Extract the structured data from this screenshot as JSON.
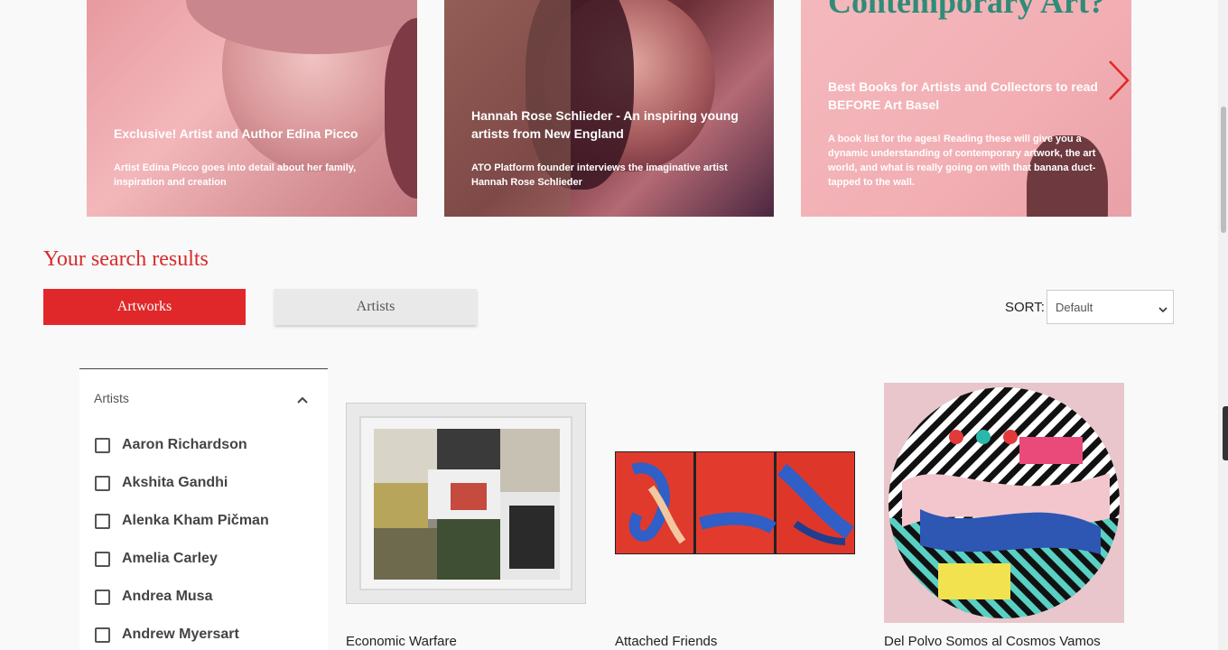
{
  "carousel": {
    "cards": [
      {
        "title": "Exclusive! Artist and Author Edina Picco",
        "desc": "Artist Edina Picco goes into detail about her family, inspiration and creation"
      },
      {
        "title": "Hannah Rose Schlieder - An inspiring young artists from New England",
        "desc": "ATO Platform founder interviews the imaginative artist Hannah Rose Schlieder"
      },
      {
        "big_title": "Contemporary Art?",
        "title": "Best Books for Artists and Collectors to read BEFORE Art Basel",
        "desc": "A book list for the ages! Reading these will give you a dynamic understanding of contemporary artwork, the art world, and what is really going on with that banana duct-tapped to the wall."
      }
    ],
    "next_icon": "chevron-right-icon"
  },
  "search": {
    "heading": "Your search results",
    "tabs": {
      "artworks": "Artworks",
      "artists": "Artists"
    },
    "sort_label": "SORT:",
    "sort_value": "Default"
  },
  "filter": {
    "title": "Artists",
    "artists": [
      "Aaron Richardson",
      "Akshita Gandhi",
      "Alenka Kham Pičman",
      "Amelia Carley",
      "Andrea Musa",
      "Andrew Myersart"
    ]
  },
  "artworks": [
    {
      "title": "Economic Warfare"
    },
    {
      "title": "Attached Friends"
    },
    {
      "title": "Del Polvo Somos al Cosmos Vamos"
    }
  ],
  "colors": {
    "accent": "#e0282a",
    "heading": "#d62b2b"
  }
}
